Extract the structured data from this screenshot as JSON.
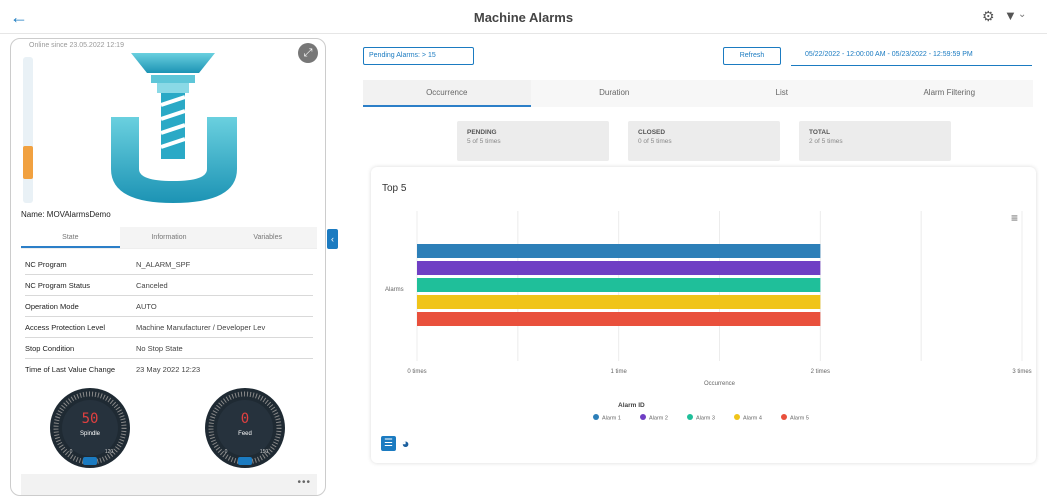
{
  "header": {
    "title": "Machine Alarms",
    "back_icon": "arrow-left-icon",
    "settings_icon": "gear-icon",
    "filter_icon": "filter-icon"
  },
  "machine": {
    "online_since": "Online since 23.05.2022 12:19",
    "name_label": "Name: ",
    "name_value": "MOVAlarmsDemo",
    "level_fraction": 0.22,
    "tabs": [
      "State",
      "Information",
      "Variables"
    ],
    "active_tab": 0,
    "properties": [
      {
        "key": "NC Program",
        "value": "N_ALARM_SPF"
      },
      {
        "key": "NC Program Status",
        "value": "Canceled"
      },
      {
        "key": "Operation Mode",
        "value": "AUTO"
      },
      {
        "key": "Access Protection Level",
        "value": "Machine Manufacturer / Developer Lev"
      },
      {
        "key": "Stop Condition",
        "value": "No Stop State"
      },
      {
        "key": "Time of Last Value Change",
        "value": "23 May 2022 12:23"
      }
    ],
    "gauges": [
      {
        "label": "Spindle",
        "value": "50",
        "min": "0",
        "max": "120",
        "color": "#e04040"
      },
      {
        "label": "Feed",
        "value": "0",
        "min": "0",
        "max": "150",
        "color": "#e04040"
      }
    ],
    "footer_more": "•••"
  },
  "controls": {
    "pending_label": "Pending Alarms: > 15",
    "refresh_label": "Refresh",
    "daterange": "05/22/2022 - 12:00:00 AM  -  05/23/2022 - 12:59:59 PM"
  },
  "tabs": [
    "Occurrence",
    "Duration",
    "List",
    "Alarm Filtering"
  ],
  "active_tab": 0,
  "kpis": [
    {
      "label": "PENDING",
      "value": "5 of 5 times"
    },
    {
      "label": "CLOSED",
      "value": "0 of 5 times"
    },
    {
      "label": "TOTAL",
      "value": "2 of 5 times"
    }
  ],
  "chart_data": {
    "type": "bar",
    "orientation": "horizontal",
    "title": "Top 5",
    "category_label": "Alarms",
    "xlabel": "Occurrence",
    "ylabel": "",
    "xlim": [
      0,
      3
    ],
    "x_ticks": [
      "0 times",
      "1 time",
      "2 times",
      "3 times"
    ],
    "series": [
      {
        "name": "Alarm 1",
        "value": 2,
        "color": "#2c7fb8"
      },
      {
        "name": "Alarm 2",
        "value": 2,
        "color": "#6f3fc4"
      },
      {
        "name": "Alarm 3",
        "value": 2,
        "color": "#1fbf9a"
      },
      {
        "name": "Alarm 4",
        "value": 2,
        "color": "#f0c419"
      },
      {
        "name": "Alarm 5",
        "value": 2,
        "color": "#e9503c"
      }
    ],
    "legend_title": "Alarm ID",
    "legend_position": "bottom",
    "grid": true
  }
}
